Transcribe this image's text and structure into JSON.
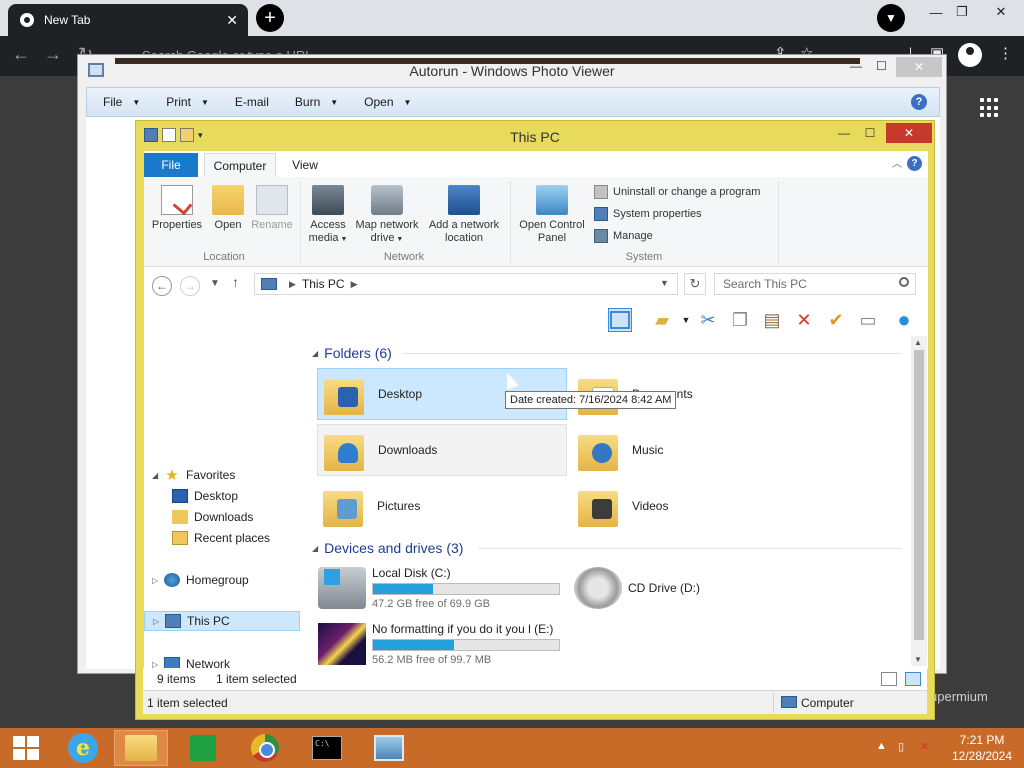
{
  "browser": {
    "tab_title": "New Tab",
    "omnibox_placeholder": "Search Google or type a URL"
  },
  "photo_viewer": {
    "title": "Autorun - Windows Photo Viewer",
    "menu": [
      {
        "label": "File"
      },
      {
        "label": "Print"
      },
      {
        "label": "E-mail"
      },
      {
        "label": "Burn"
      },
      {
        "label": "Open"
      }
    ]
  },
  "explorer": {
    "title": "This PC",
    "ribbon_tabs": {
      "file": "File",
      "computer": "Computer",
      "view": "View"
    },
    "ribbon": {
      "location": {
        "label": "Location",
        "properties": "Properties",
        "open": "Open",
        "rename": "Rename"
      },
      "network": {
        "label": "Network",
        "access_media_1": "Access",
        "access_media_2": "media",
        "map_drive_1": "Map network",
        "map_drive_2": "drive",
        "add_location_1": "Add a network",
        "add_location_2": "location"
      },
      "system": {
        "label": "System",
        "control_panel_1": "Open Control",
        "control_panel_2": "Panel",
        "uninstall": "Uninstall or change a program",
        "system_properties": "System properties",
        "manage": "Manage"
      }
    },
    "address": {
      "path": "This PC",
      "search_placeholder": "Search This PC"
    },
    "nav": {
      "favorites": "Favorites",
      "desktop": "Desktop",
      "downloads": "Downloads",
      "recent": "Recent places",
      "homegroup": "Homegroup",
      "this_pc": "This PC",
      "network": "Network"
    },
    "folders_header": "Folders (6)",
    "folders": {
      "desktop": "Desktop",
      "documents": "Documents",
      "downloads": "Downloads",
      "music": "Music",
      "pictures": "Pictures",
      "videos": "Videos"
    },
    "drives_header": "Devices and drives (3)",
    "drives": {
      "c": {
        "name": "Local Disk (C:)",
        "free": "47.2 GB free of 69.9 GB",
        "used_fraction": 0.325
      },
      "d": {
        "name": "CD Drive (D:)"
      },
      "e": {
        "name": "No formatting if you do it you l (E:)",
        "free": "56.2 MB free of 99.7 MB",
        "used_fraction": 0.436
      }
    },
    "tooltip": "Date created: 7/16/2024 8:42 AM",
    "status": {
      "items": "9 items",
      "selected": "1 item selected",
      "bottom_left": "1 item selected",
      "bottom_right": "Computer"
    }
  },
  "background_text": "upermium",
  "taskbar": {
    "time": "7:21 PM",
    "date": "12/28/2024"
  },
  "colors": {
    "explorer_frame": "#e8da5a",
    "taskbar": "#c86b28",
    "accent": "#1979ca"
  }
}
